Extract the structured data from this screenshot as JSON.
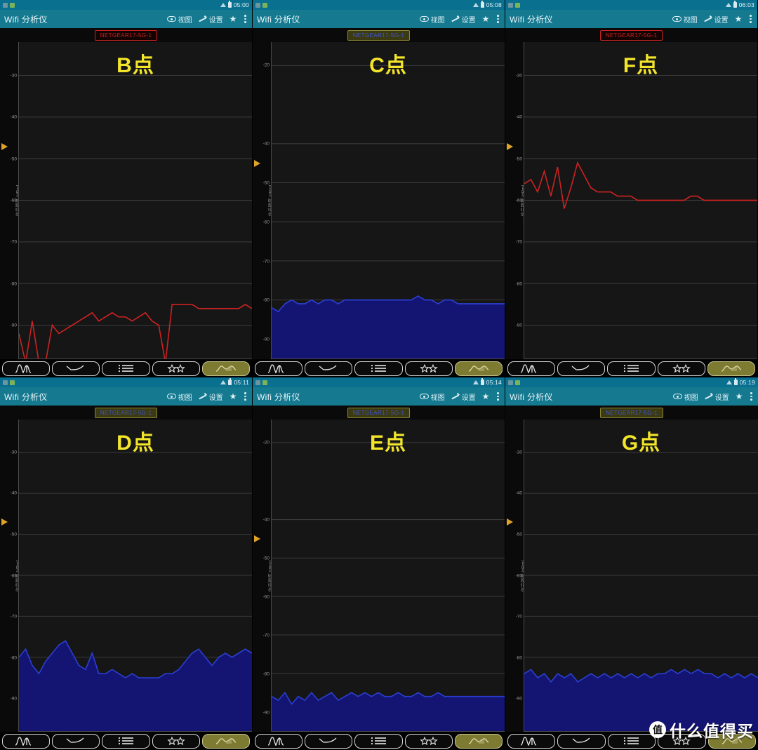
{
  "app": {
    "title": "Wifi 分析仪",
    "actions": {
      "view_label": "视图",
      "settings_label": "设置",
      "star_glyph": "★"
    }
  },
  "colors": {
    "statusbar": "#0a7090",
    "appbar": "#15798f",
    "title_yellow": "#f2e52a",
    "trace_red": "#cc2222",
    "trace_blue": "#2a3fd0",
    "fill_blue": "#141473",
    "toolbar_active": "#7d7a32",
    "cursor_marker": "#e0a32a"
  },
  "toolbar": {
    "buttons": [
      {
        "name": "channel-graph",
        "icon": "two-peaks-icon",
        "active": false
      },
      {
        "name": "time-graph",
        "icon": "arc-curve-icon",
        "active": false
      },
      {
        "name": "channel-rating",
        "icon": "list-lines-icon",
        "active": false
      },
      {
        "name": "access-points",
        "icon": "two-stars-icon",
        "active": false
      },
      {
        "name": "signal-meter",
        "icon": "signal-trace-icon",
        "active": true
      }
    ]
  },
  "watermark": {
    "badge": "值",
    "text": "什么值得买"
  },
  "panels": [
    {
      "id": "B",
      "title": "B点",
      "time": "05:00",
      "ssid": "NETGEAR17-5G-1",
      "ssid_style": "red",
      "trace_style": "line-red",
      "yticks": [
        -30,
        -40,
        -50,
        -60,
        -70,
        -80,
        -90
      ],
      "ylabel": "信号强度 [dBm]",
      "ylim": [
        -22,
        -98
      ],
      "cursor_dbm": -47,
      "series": [
        -92,
        -99,
        -89,
        -99,
        -99,
        -90,
        -92,
        -91,
        -90,
        -89,
        -88,
        -87,
        -89,
        -88,
        -87,
        -88,
        -88,
        -89,
        -88,
        -87,
        -89,
        -90,
        -99,
        -85,
        -85,
        -85,
        -85,
        -86,
        -86,
        -86,
        -86,
        -86,
        -86,
        -86,
        -85,
        -86
      ]
    },
    {
      "id": "C",
      "title": "C点",
      "time": "05:08",
      "ssid": "NETGEAR17-5G-1",
      "ssid_style": "blue",
      "trace_style": "area-blue",
      "yticks": [
        -20,
        -40,
        -50,
        -60,
        -70,
        -80,
        -90
      ],
      "ylabel": "信号强度 [dBm]",
      "ylim": [
        -14,
        -95
      ],
      "cursor_dbm": -45,
      "series": [
        -82,
        -83,
        -81,
        -80,
        -81,
        -81,
        -80,
        -81,
        -80,
        -80,
        -81,
        -80,
        -80,
        -80,
        -80,
        -80,
        -80,
        -80,
        -80,
        -80,
        -80,
        -80,
        -79,
        -80,
        -80,
        -81,
        -80,
        -80,
        -81,
        -81,
        -81,
        -81,
        -81,
        -81,
        -81,
        -81
      ]
    },
    {
      "id": "F",
      "title": "F点",
      "time": "06:03",
      "ssid": "NETGEAR17-5G-1",
      "ssid_style": "red",
      "trace_style": "line-red",
      "yticks": [
        -30,
        -40,
        -50,
        -60,
        -70,
        -80,
        -90
      ],
      "ylabel": "信号强度 [dBm]",
      "ylim": [
        -22,
        -98
      ],
      "cursor_dbm": -47,
      "series": [
        -56,
        -55,
        -58,
        -53,
        -59,
        -52,
        -62,
        -57,
        -51,
        -54,
        -57,
        -58,
        -58,
        -58,
        -59,
        -59,
        -59,
        -60,
        -60,
        -60,
        -60,
        -60,
        -60,
        -60,
        -60,
        -59,
        -59,
        -60,
        -60,
        -60,
        -60,
        -60,
        -60,
        -60,
        -60,
        -60
      ]
    },
    {
      "id": "D",
      "title": "D点",
      "time": "05:11",
      "ssid": "NETGEAR17-5G-1",
      "ssid_style": "blue",
      "trace_style": "area-blue",
      "yticks": [
        -30,
        -40,
        -50,
        -60,
        -70,
        -80,
        -90
      ],
      "ylabel": "信号强度 [dBm]",
      "ylim": [
        -22,
        -98
      ],
      "cursor_dbm": -47,
      "series": [
        -80,
        -78,
        -82,
        -84,
        -81,
        -79,
        -77,
        -76,
        -79,
        -82,
        -83,
        -79,
        -84,
        -84,
        -83,
        -84,
        -85,
        -84,
        -85,
        -85,
        -85,
        -85,
        -84,
        -84,
        -83,
        -81,
        -79,
        -78,
        -80,
        -82,
        -80,
        -79,
        -80,
        -79,
        -78,
        -79
      ]
    },
    {
      "id": "E",
      "title": "E点",
      "time": "05:14",
      "ssid": "NETGEAR17-5G-1",
      "ssid_style": "blue",
      "trace_style": "area-blue",
      "yticks": [
        -20,
        -40,
        -50,
        -60,
        -70,
        -80,
        -90
      ],
      "ylabel": "信号强度 [dBm]",
      "ylim": [
        -14,
        -95
      ],
      "cursor_dbm": -45,
      "series": [
        -86,
        -87,
        -85,
        -88,
        -86,
        -87,
        -85,
        -87,
        -86,
        -85,
        -87,
        -86,
        -85,
        -86,
        -85,
        -86,
        -85,
        -86,
        -86,
        -85,
        -86,
        -86,
        -85,
        -86,
        -86,
        -85,
        -86,
        -86,
        -86,
        -86,
        -86,
        -86,
        -86,
        -86,
        -86,
        -86
      ]
    },
    {
      "id": "G",
      "title": "G点",
      "time": "05:19",
      "ssid": "NETGEAR17-5G-1",
      "ssid_style": "blue",
      "trace_style": "area-blue",
      "yticks": [
        -30,
        -40,
        -50,
        -60,
        -70,
        -80,
        -90
      ],
      "ylabel": "信号强度 [dBm]",
      "ylim": [
        -22,
        -98
      ],
      "cursor_dbm": -47,
      "series": [
        -84,
        -83,
        -85,
        -84,
        -86,
        -84,
        -85,
        -84,
        -86,
        -85,
        -84,
        -85,
        -84,
        -85,
        -84,
        -85,
        -84,
        -85,
        -84,
        -85,
        -84,
        -84,
        -83,
        -84,
        -83,
        -84,
        -83,
        -84,
        -84,
        -85,
        -84,
        -85,
        -84,
        -85,
        -84,
        -85
      ]
    }
  ]
}
